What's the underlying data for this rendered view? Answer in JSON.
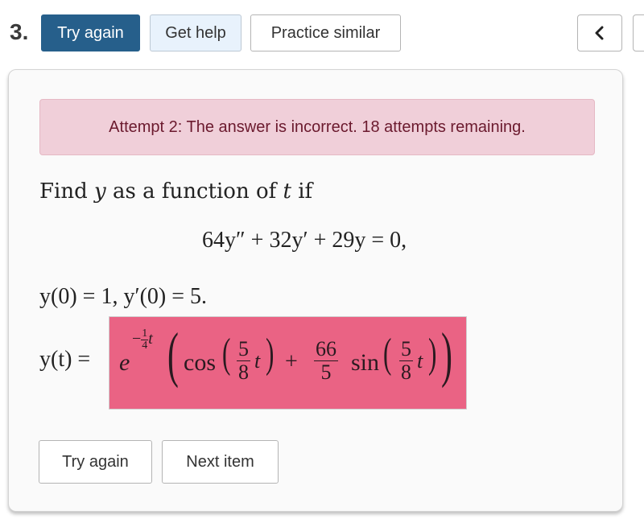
{
  "header": {
    "question_number": "3.",
    "buttons": {
      "try_again": "Try again",
      "get_help": "Get help",
      "practice_similar": "Practice similar"
    },
    "nav": {
      "prev_icon": "chevron-left-icon",
      "prev_glyph": "‹"
    }
  },
  "alert": {
    "message": "Attempt 2: The answer is incorrect. 18 attempts remaining.",
    "color": "#f0cfd9"
  },
  "problem": {
    "prompt_parts": [
      "Find ",
      "y",
      " as a function of ",
      "t",
      " if"
    ],
    "equation": "64y″ + 32y′ + 29y = 0,",
    "initial_conditions": "y(0) = 1,   y′(0) = 5."
  },
  "answer": {
    "label": "y(t) =",
    "status": "incorrect",
    "highlight_color": "#ea6384",
    "base": "e",
    "exponent_sign": "−",
    "exponent_num": "1",
    "exponent_den": "4",
    "exponent_var": "t",
    "cos_label": "cos",
    "cos_arg_num": "5",
    "cos_arg_den": "8",
    "plus": "+",
    "coef_num": "66",
    "coef_den": "5",
    "sin_label": "sin",
    "sin_arg_num": "5",
    "sin_arg_den": "8",
    "var": "t"
  },
  "footer": {
    "try_again": "Try again",
    "next_item": "Next item"
  }
}
